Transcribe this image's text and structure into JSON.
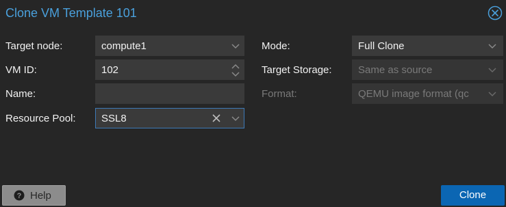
{
  "dialog": {
    "title": "Clone VM Template 101"
  },
  "form": {
    "target_node": {
      "label": "Target node:",
      "value": "compute1"
    },
    "vm_id": {
      "label": "VM ID:",
      "value": "102"
    },
    "name": {
      "label": "Name:",
      "value": ""
    },
    "resource_pool": {
      "label": "Resource Pool:",
      "value": "SSL8"
    },
    "mode": {
      "label": "Mode:",
      "value": "Full Clone"
    },
    "target_storage": {
      "label": "Target Storage:",
      "value": "Same as source"
    },
    "format": {
      "label": "Format:",
      "value": "QEMU image format (qc"
    }
  },
  "buttons": {
    "help": "Help",
    "clone": "Clone"
  },
  "colors": {
    "accent": "#4aa0dc",
    "primary_button": "#0b66b3",
    "background": "#262626"
  },
  "icons": {
    "close": "close-circle-icon",
    "help": "question-circle-icon",
    "dropdown": "chevron-down-icon",
    "spinner": "spinner-updown-icon",
    "clear": "clear-x-icon"
  }
}
